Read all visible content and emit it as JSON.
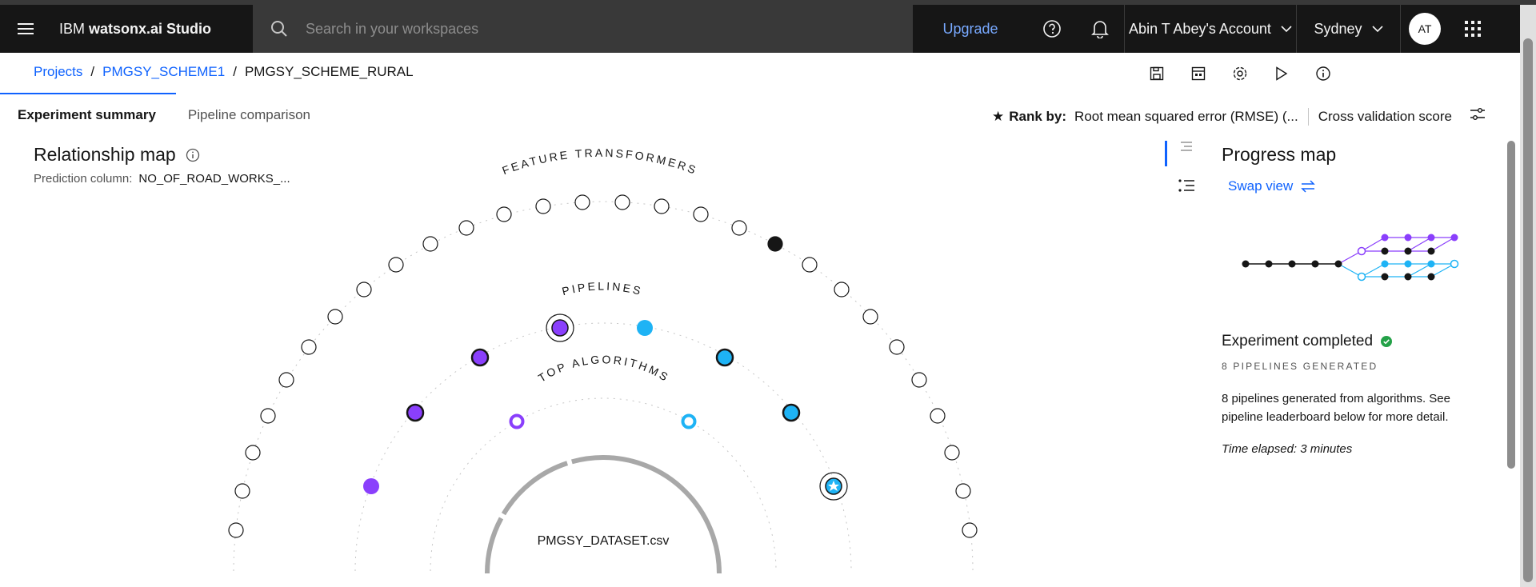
{
  "header": {
    "brand_prefix": "IBM ",
    "brand_name": "watsonx.ai Studio",
    "search_placeholder": "Search in your workspaces",
    "upgrade_label": "Upgrade",
    "account_label": "Abin T Abey's Account",
    "region_label": "Sydney",
    "avatar_initials": "AT"
  },
  "breadcrumb": {
    "items": [
      "Projects",
      "PMGSY_SCHEME1",
      "PMGSY_SCHEME_RURAL"
    ],
    "separator": "/"
  },
  "toolbar": {
    "icons": [
      "save-icon",
      "template-icon",
      "settings-icon",
      "run-icon",
      "info-icon"
    ]
  },
  "tabs": {
    "experiment_summary": "Experiment summary",
    "pipeline_comparison": "Pipeline comparison"
  },
  "rank": {
    "label": "Rank by:",
    "metric": "Root mean squared error (RMSE) (...",
    "score": "Cross validation score"
  },
  "relationship_map": {
    "title": "Relationship map",
    "prediction_label": "Prediction column:",
    "prediction_value": "NO_OF_ROAD_WORKS_...",
    "ring_feature": "FEATURE TRANSFORMERS",
    "ring_pipelines": "PIPELINES",
    "ring_algorithms": "TOP ALGORITHMS",
    "dataset": "PMGSY_DATASET.csv"
  },
  "progress_map": {
    "title": "Progress map",
    "swap_label": "Swap view",
    "status": "Experiment completed",
    "count": "8 PIPELINES GENERATED",
    "description": "8 pipelines generated from algorithms. See pipeline leaderboard below for more detail.",
    "elapsed": "Time elapsed: 3 minutes"
  },
  "colors": {
    "purple": "#8a3ffc",
    "cyan": "#1eb3f5",
    "link": "#0f62fe",
    "success": "#24a148"
  }
}
